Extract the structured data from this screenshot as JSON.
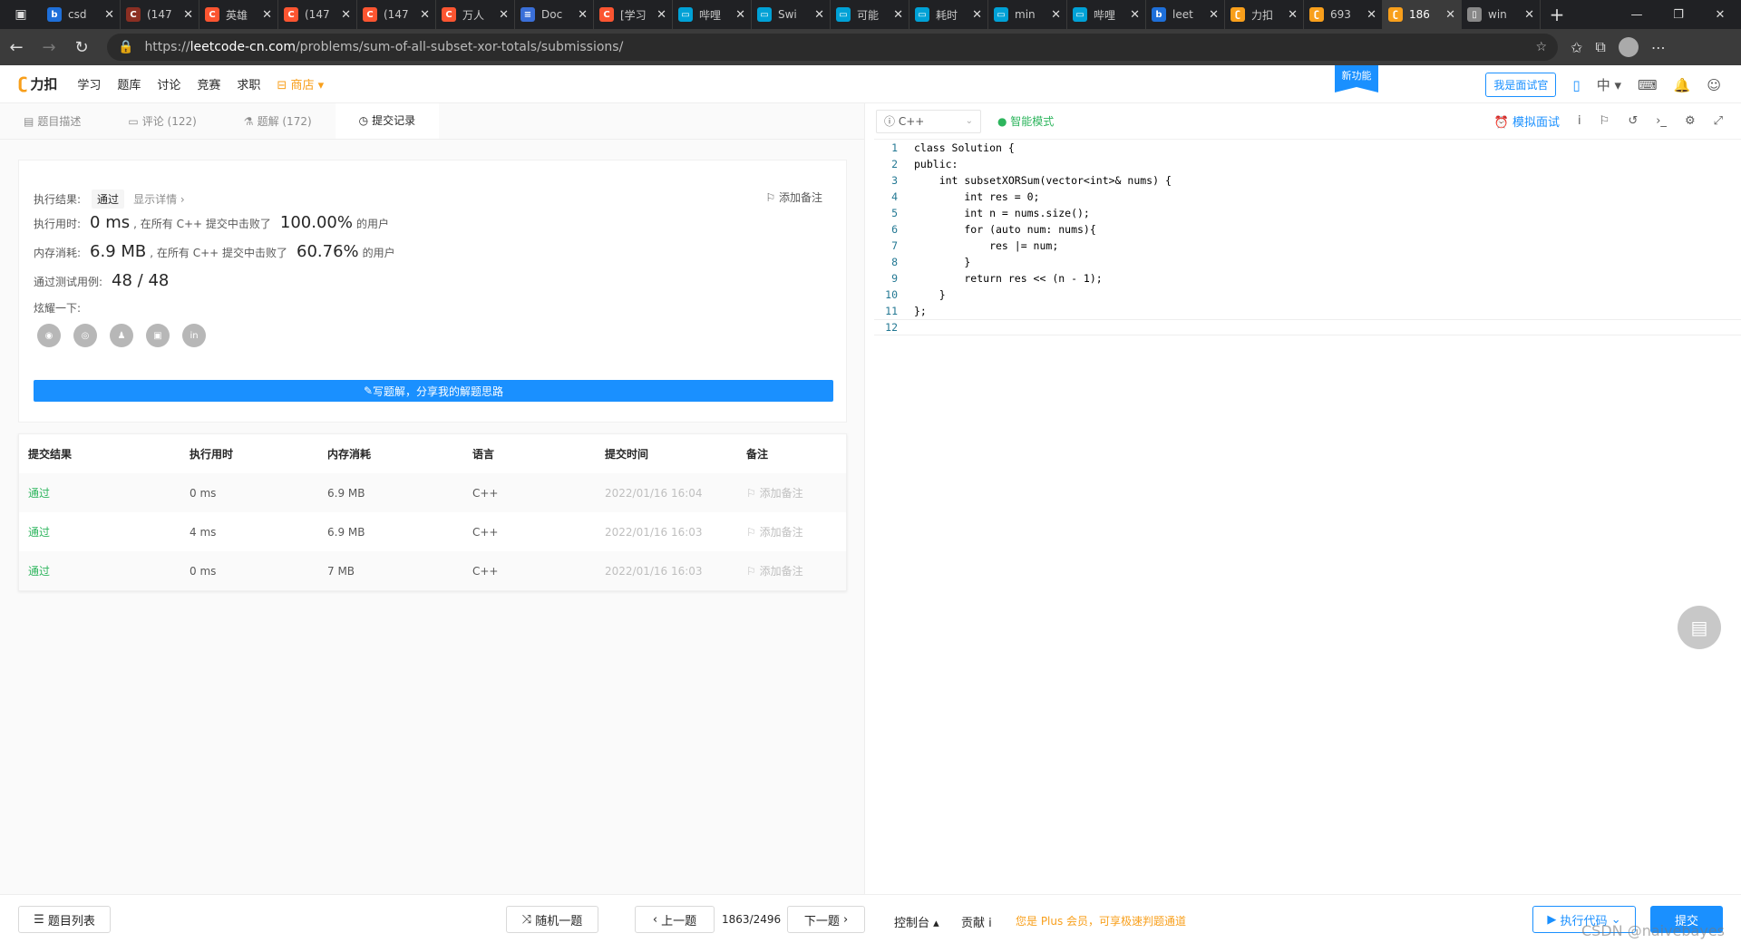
{
  "browser": {
    "tabs": [
      {
        "title": "csd",
        "icon": "bing-icon",
        "color": "#1e6fd9"
      },
      {
        "title": "(147",
        "icon": "csdn-icon",
        "color": "#8b2f23"
      },
      {
        "title": "英雄",
        "icon": "csdn-icon",
        "color": "#fc5531"
      },
      {
        "title": "(147",
        "icon": "csdn-icon",
        "color": "#fc5531"
      },
      {
        "title": "(147",
        "icon": "csdn-icon",
        "color": "#fc5531"
      },
      {
        "title": "万人",
        "icon": "csdn-icon",
        "color": "#fc5531"
      },
      {
        "title": "Doc",
        "icon": "doc-icon",
        "color": "#3a6fd8"
      },
      {
        "title": "[学习",
        "icon": "csdn-icon",
        "color": "#fc5531"
      },
      {
        "title": "哔哩",
        "icon": "bilibili-icon",
        "color": "#00a1d6"
      },
      {
        "title": "Swi",
        "icon": "bilibili-icon",
        "color": "#00a1d6"
      },
      {
        "title": "可能",
        "icon": "bilibili-icon",
        "color": "#00a1d6"
      },
      {
        "title": "耗时",
        "icon": "bilibili-icon",
        "color": "#00a1d6"
      },
      {
        "title": "min",
        "icon": "bilibili-icon",
        "color": "#00a1d6"
      },
      {
        "title": "哔哩",
        "icon": "bilibili-icon",
        "color": "#00a1d6"
      },
      {
        "title": "leet",
        "icon": "bing-icon",
        "color": "#1e6fd9"
      },
      {
        "title": "力扣",
        "icon": "leetcode-icon",
        "color": "#f89f1b"
      },
      {
        "title": "693",
        "icon": "leetcode-icon",
        "color": "#f89f1b"
      },
      {
        "title": "186",
        "icon": "leetcode-icon",
        "color": "#f89f1b",
        "active": true
      },
      {
        "title": "win",
        "icon": "page-icon",
        "color": "#888888"
      }
    ],
    "url_prefix": "https://",
    "url_domain": "leetcode-cn.com",
    "url_path": "/problems/sum-of-all-subset-xor-totals/submissions/"
  },
  "site": {
    "logo": "力扣",
    "nav": [
      "学习",
      "题库",
      "讨论",
      "竞赛",
      "求职"
    ],
    "store": "商店",
    "new_feature": "新功能",
    "interviewer": "我是面试官",
    "lang": "中"
  },
  "left_tabs": [
    {
      "label": "题目描述",
      "icon": "doc-icon"
    },
    {
      "label": "评论 (122)",
      "icon": "comment-icon"
    },
    {
      "label": "题解 (172)",
      "icon": "flask-icon"
    },
    {
      "label": "提交记录",
      "icon": "clock-icon",
      "active": true
    }
  ],
  "result": {
    "status_label": "执行结果:",
    "status": "通过",
    "details": "显示详情 ›",
    "add_note": "添加备注",
    "runtime_label": "执行用时:",
    "runtime": "0 ms",
    "runtime_text": ", 在所有 C++ 提交中击败了",
    "runtime_pct": "100.00%",
    "runtime_suffix": "的用户",
    "memory_label": "内存消耗:",
    "memory": "6.9 MB",
    "memory_text": ", 在所有 C++ 提交中击败了",
    "memory_pct": "60.76%",
    "memory_suffix": "的用户",
    "cases_label": "通过测试用例:",
    "cases": "48  /  48",
    "share_label": "炫耀一下:",
    "write_btn": "写题解，分享我的解题思路"
  },
  "table": {
    "headers": [
      "提交结果",
      "执行用时",
      "内存消耗",
      "语言",
      "提交时间",
      "备注"
    ],
    "rows": [
      [
        "通过",
        "0 ms",
        "6.9 MB",
        "C++",
        "2022/01/16 16:04",
        "添加备注"
      ],
      [
        "通过",
        "4 ms",
        "6.9 MB",
        "C++",
        "2022/01/16 16:03",
        "添加备注"
      ],
      [
        "通过",
        "0 ms",
        "7 MB",
        "C++",
        "2022/01/16 16:03",
        "添加备注"
      ]
    ]
  },
  "editor": {
    "language": "C++",
    "mode": "智能模式",
    "mock_interview": "模拟面试",
    "lines": [
      "class Solution {",
      "public:",
      "    int subsetXORSum(vector<int>& nums) {",
      "        int res = 0;",
      "        int n = nums.size();",
      "        for (auto num: nums){",
      "            res |= num;",
      "        }",
      "        return res << (n - 1);",
      "    }",
      "};",
      ""
    ]
  },
  "bottom": {
    "problem_list": "题目列表",
    "random": "随机一题",
    "prev": "上一题",
    "page": "1863/2496",
    "next": "下一题",
    "console": "控制台",
    "contribute": "贡献 i",
    "plus": "您是 Plus 会员，可享极速判题通道",
    "run": "执行代码",
    "submit": "提交",
    "watermark": "CSDN @naivebayes"
  }
}
